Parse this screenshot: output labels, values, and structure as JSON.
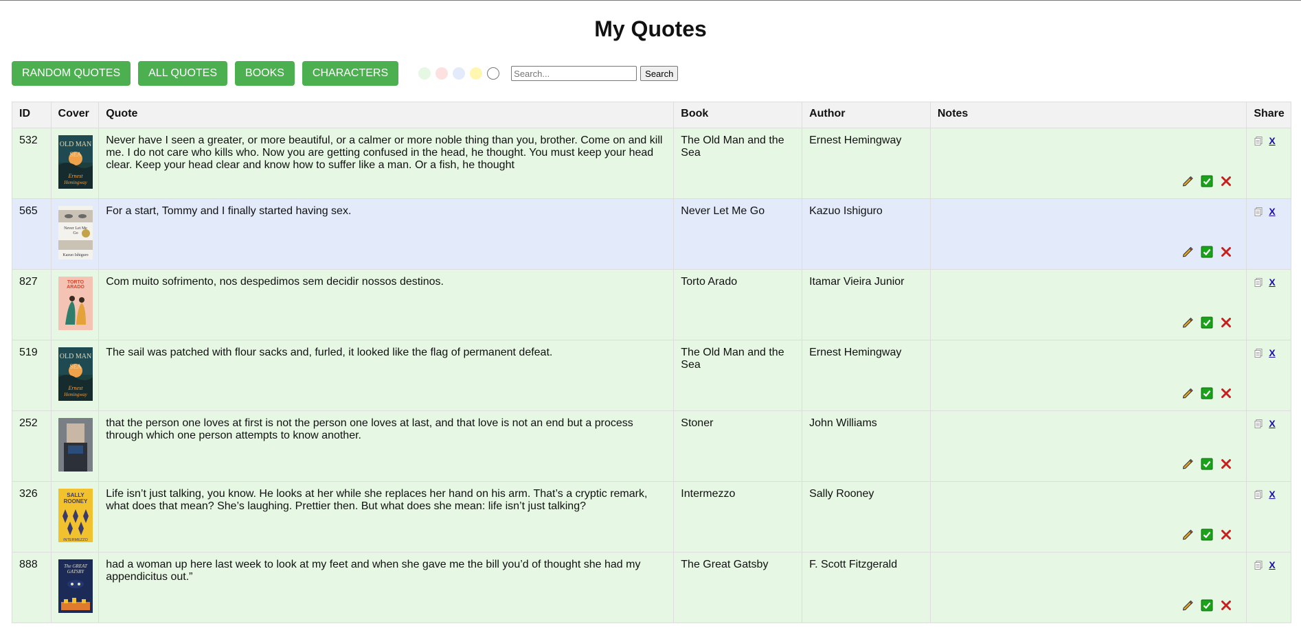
{
  "page": {
    "title": "My Quotes"
  },
  "nav": {
    "random_label": "RANDOM QUOTES",
    "all_label": "ALL QUOTES",
    "books_label": "BOOKS",
    "characters_label": "CHARACTERS"
  },
  "color_filters": [
    {
      "name": "green",
      "color": "#e6f7e4"
    },
    {
      "name": "red",
      "color": "#fde0e0"
    },
    {
      "name": "blue",
      "color": "#e3ebfb"
    },
    {
      "name": "yellow",
      "color": "#fff7b0"
    },
    {
      "name": "none",
      "color": "#ffffff"
    }
  ],
  "search": {
    "placeholder": "Search...",
    "value": "",
    "button_label": "Search"
  },
  "table": {
    "headers": {
      "id": "ID",
      "cover": "Cover",
      "quote": "Quote",
      "book": "Book",
      "author": "Author",
      "notes": "Notes",
      "share": "Share"
    },
    "share_x_label": "X",
    "rows": [
      {
        "id": "532",
        "quote": "Never have I seen a greater, or more beautiful, or a calmer or more noble thing than you, brother. Come on and kill me. I do not care who kills who. Now you are getting confused in the head, he thought. You must keep your head clear. Keep your head clear and know how to suffer like a man. Or a fish, he thought",
        "book": "The Old Man and the Sea",
        "author": "Ernest Hemingway",
        "notes": "",
        "row_color": "green",
        "cover": "old-man-sea"
      },
      {
        "id": "565",
        "quote": "For a start, Tommy and I finally started having sex.",
        "book": "Never Let Me Go",
        "author": "Kazuo Ishiguro",
        "notes": "",
        "row_color": "blue",
        "cover": "never-let-me-go"
      },
      {
        "id": "827",
        "quote": "Com muito sofrimento, nos despedimos sem decidir nossos destinos.",
        "book": "Torto Arado",
        "author": "Itamar Vieira Junior",
        "notes": "",
        "row_color": "green",
        "cover": "torto-arado"
      },
      {
        "id": "519",
        "quote": "The sail was patched with flour sacks and, furled, it looked like the flag of permanent defeat.",
        "book": "The Old Man and the Sea",
        "author": "Ernest Hemingway",
        "notes": "",
        "row_color": "green",
        "cover": "old-man-sea"
      },
      {
        "id": "252",
        "quote": "that the person one loves at first is not the person one loves at last, and that love is not an end but a process through which one person attempts to know another.",
        "book": "Stoner",
        "author": "John Williams",
        "notes": "",
        "row_color": "green",
        "cover": "stoner"
      },
      {
        "id": "326",
        "quote": "Life isn’t just talking, you know. He looks at her while she replaces her hand on his arm. That’s a cryptic remark, what does that mean? She’s laughing. Prettier then. But what does she mean: life isn’t just talking?",
        "book": "Intermezzo",
        "author": "Sally Rooney",
        "notes": "",
        "row_color": "green",
        "cover": "intermezzo"
      },
      {
        "id": "888",
        "quote": "had a woman up here last week to look at my feet and when she gave me the bill you’d of thought she had my appendicitus out.”",
        "book": "The Great Gatsby",
        "author": "F. Scott Fitzgerald",
        "notes": "",
        "row_color": "green",
        "cover": "great-gatsby"
      }
    ]
  }
}
